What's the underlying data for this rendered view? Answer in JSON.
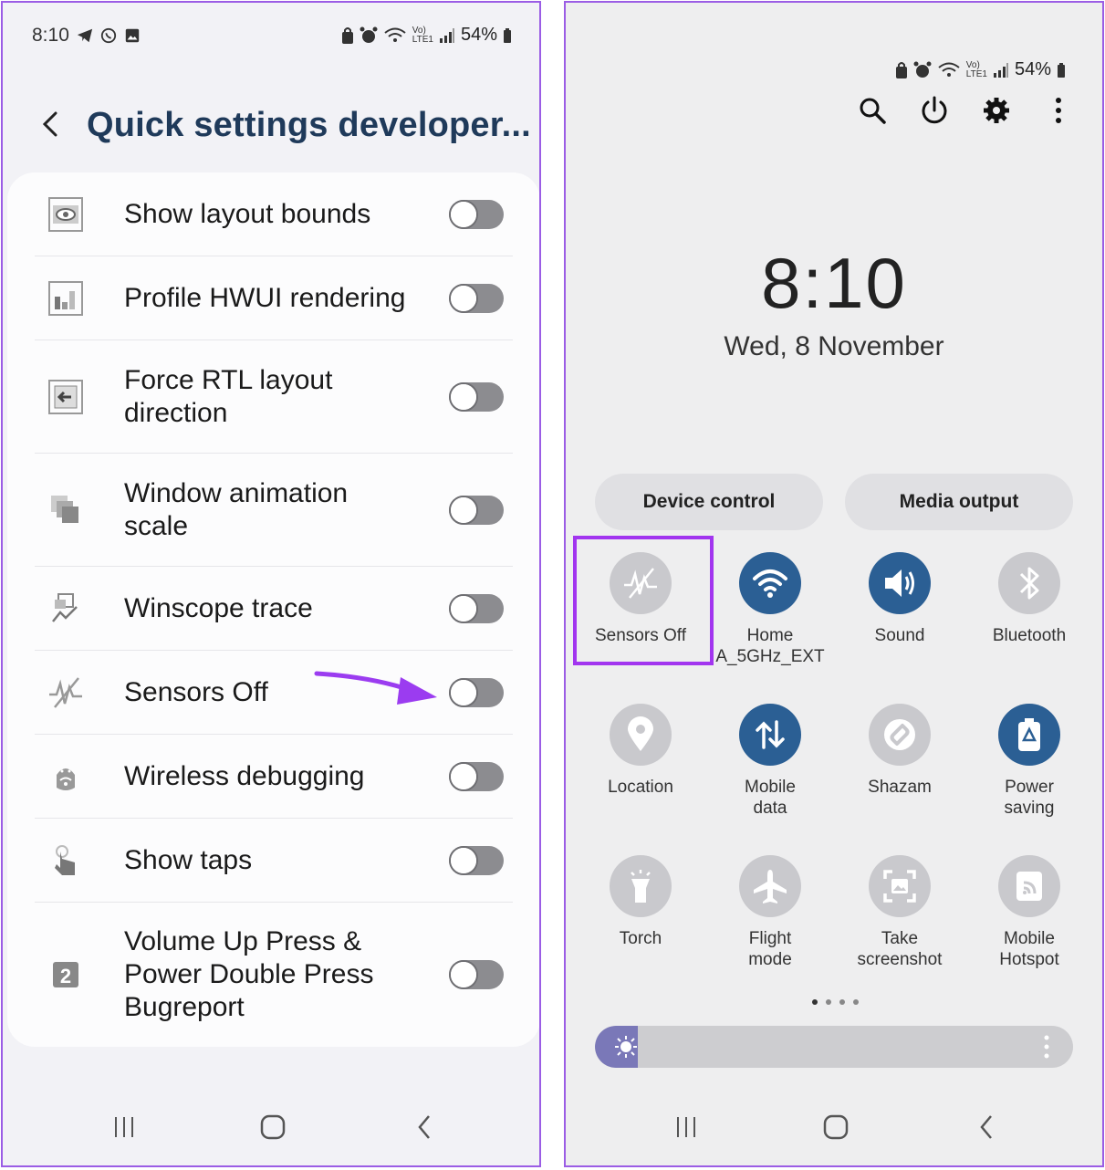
{
  "left": {
    "status": {
      "time": "8:10",
      "battery": "54%"
    },
    "header": {
      "title": "Quick settings developer..."
    },
    "settings": [
      {
        "label": "Show layout bounds",
        "icon": "layout-bounds-icon",
        "enabled": false
      },
      {
        "label": "Profile HWUI rendering",
        "icon": "hwui-icon",
        "enabled": false
      },
      {
        "label": "Force RTL layout\ndirection",
        "icon": "rtl-icon",
        "enabled": false
      },
      {
        "label": "Window animation\nscale",
        "icon": "window-animation-icon",
        "enabled": false
      },
      {
        "label": "Winscope trace",
        "icon": "winscope-icon",
        "enabled": false
      },
      {
        "label": "Sensors Off",
        "icon": "sensors-off-icon",
        "enabled": false
      },
      {
        "label": "Wireless debugging",
        "icon": "wireless-debugging-icon",
        "enabled": false
      },
      {
        "label": "Show taps",
        "icon": "show-taps-icon",
        "enabled": false
      },
      {
        "label": "Volume Up Press &\nPower Double Press\nBugreport",
        "icon": "bugreport-icon",
        "enabled": false
      }
    ],
    "annotation_color": "#9b3cf0"
  },
  "right": {
    "status": {
      "battery": "54%"
    },
    "clock": {
      "time": "8:10",
      "date": "Wed, 8 November"
    },
    "buttons": {
      "device_control": "Device control",
      "media_output": "Media output"
    },
    "tiles": [
      {
        "label": "Sensors Off",
        "icon": "sensors-off-icon",
        "on": false,
        "highlighted": true
      },
      {
        "label": "Home\nA_5GHz_EXT",
        "icon": "wifi-icon",
        "on": true
      },
      {
        "label": "Sound",
        "icon": "sound-icon",
        "on": true
      },
      {
        "label": "Bluetooth",
        "icon": "bluetooth-icon",
        "on": false
      },
      {
        "label": "Location",
        "icon": "location-icon",
        "on": false
      },
      {
        "label": "Mobile\ndata",
        "icon": "mobile-data-icon",
        "on": true
      },
      {
        "label": "Shazam",
        "icon": "shazam-icon",
        "on": false
      },
      {
        "label": "Power\nsaving",
        "icon": "power-saving-icon",
        "on": true
      },
      {
        "label": "Torch",
        "icon": "torch-icon",
        "on": false
      },
      {
        "label": "Flight\nmode",
        "icon": "flight-mode-icon",
        "on": false
      },
      {
        "label": "Take\nscreenshot",
        "icon": "screenshot-icon",
        "on": false
      },
      {
        "label": "Mobile\nHotspot",
        "icon": "hotspot-icon",
        "on": false
      }
    ],
    "page_indicator": {
      "pages": 4,
      "current": 1
    },
    "brightness": 0.09,
    "highlight_color": "#a235ef"
  }
}
